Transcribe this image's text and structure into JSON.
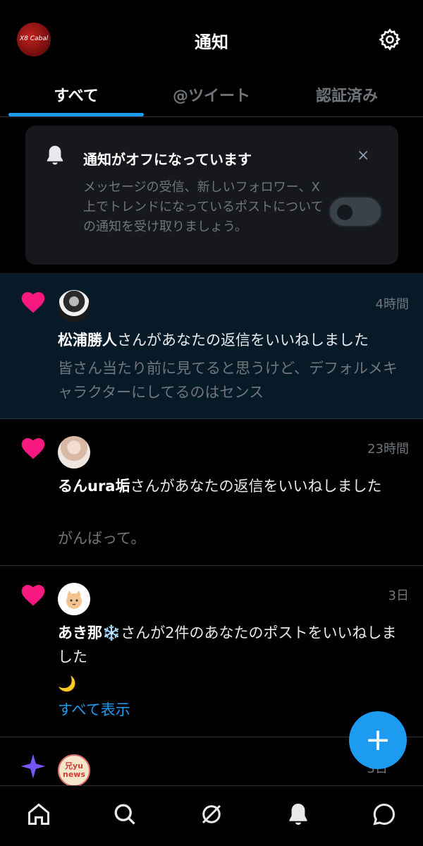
{
  "header": {
    "title": "通知",
    "avatar_logo_text": "X8 Cabal"
  },
  "tabs": [
    {
      "label": "すべて"
    },
    {
      "label": "@ツイート"
    },
    {
      "label": "認証済み"
    }
  ],
  "notice": {
    "title": "通知がオフになっています",
    "close": "×",
    "body": "メッセージの受信、新しいフォロワー、X上でトレンドになっているポストについての通知を受け取りましょう。",
    "toggle_on": false
  },
  "notifications": [
    {
      "time": "4時間",
      "name": "松浦勝人",
      "action": "さんがあなたの返信をいいねしました",
      "preview": "皆さん当たり前に見てると思うけど、デフォルメキャラクターにしてるのはセンス"
    },
    {
      "time": "23時間",
      "name": "るんura垢",
      "action": "さんがあなたの返信をいいねしました",
      "preview": "がんばって。"
    },
    {
      "time": "3日",
      "name": "あき那❄️",
      "action": "さんが2件のあなたのポストをいいねしました",
      "preview": "🌙",
      "link": "すべて表示"
    },
    {
      "time": "3日",
      "avatar_text": "兄yu news"
    }
  ],
  "fab": {
    "label": "+"
  },
  "colors": {
    "accent": "#1d9bf0",
    "heart": "#f91880",
    "sparkle": "#7856ff",
    "unread_bg": "#061a28"
  },
  "icons": [
    "home-icon",
    "search-icon",
    "grok-icon",
    "bell-icon",
    "messages-icon",
    "gear-icon",
    "heart-icon",
    "sparkle-icon"
  ]
}
